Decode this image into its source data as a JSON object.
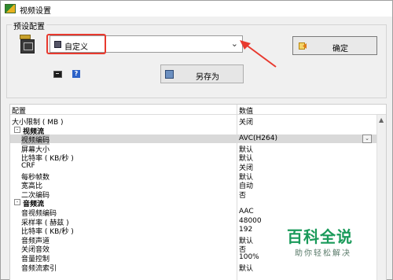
{
  "window": {
    "title": "视频设置"
  },
  "preset": {
    "group_label": "预设配置",
    "selected": "自定义",
    "ok_label": "确定",
    "save_as_label": "另存为"
  },
  "help": {
    "glyph": "?"
  },
  "grid": {
    "header": {
      "name": "配置",
      "value": "数值"
    },
    "rows": [
      {
        "type": "item",
        "indent": 0,
        "label": "大小限制 ( MB )",
        "value": "关闭"
      },
      {
        "type": "section",
        "label": "视频流",
        "toggle": "-"
      },
      {
        "type": "item",
        "indent": 1,
        "label": "视频编码",
        "value": "AVC(H264)",
        "selected": true,
        "dropdown": true
      },
      {
        "type": "item",
        "indent": 1,
        "label": "屏幕大小",
        "value": "默认"
      },
      {
        "type": "item",
        "indent": 1,
        "label": "比特率 ( KB/秒 )",
        "value": "默认"
      },
      {
        "type": "item",
        "indent": 1,
        "label": "CRF",
        "value": "关闭"
      },
      {
        "type": "item",
        "indent": 1,
        "label": "每秒帧数",
        "value": "默认"
      },
      {
        "type": "item",
        "indent": 1,
        "label": "宽高比",
        "value": "自动"
      },
      {
        "type": "item",
        "indent": 1,
        "label": "二次编码",
        "value": "否"
      },
      {
        "type": "section",
        "label": "音频流",
        "toggle": "-"
      },
      {
        "type": "item",
        "indent": 1,
        "label": "音视频编码",
        "value": "AAC"
      },
      {
        "type": "item",
        "indent": 1,
        "label": "采样率 ( 赫兹 )",
        "value": "48000"
      },
      {
        "type": "item",
        "indent": 1,
        "label": "比特率 ( KB/秒 )",
        "value": "192"
      },
      {
        "type": "item",
        "indent": 1,
        "label": "音频声道",
        "value": "默认"
      },
      {
        "type": "item",
        "indent": 1,
        "label": "关闭音效",
        "value": "否"
      },
      {
        "type": "item",
        "indent": 1,
        "label": "音量控制",
        "value": "100%"
      },
      {
        "type": "item",
        "indent": 1,
        "label": "音频流索引",
        "value": "默认"
      }
    ],
    "dropdown_glyph": "⌄",
    "scroll_up_glyph": "▲"
  },
  "watermark": {
    "title": "百科全说",
    "subtitle": "助你轻松解决"
  },
  "colors": {
    "annotation": "#e8392e",
    "watermark": "#1a9a5a",
    "selection": "#d9d9d9"
  }
}
